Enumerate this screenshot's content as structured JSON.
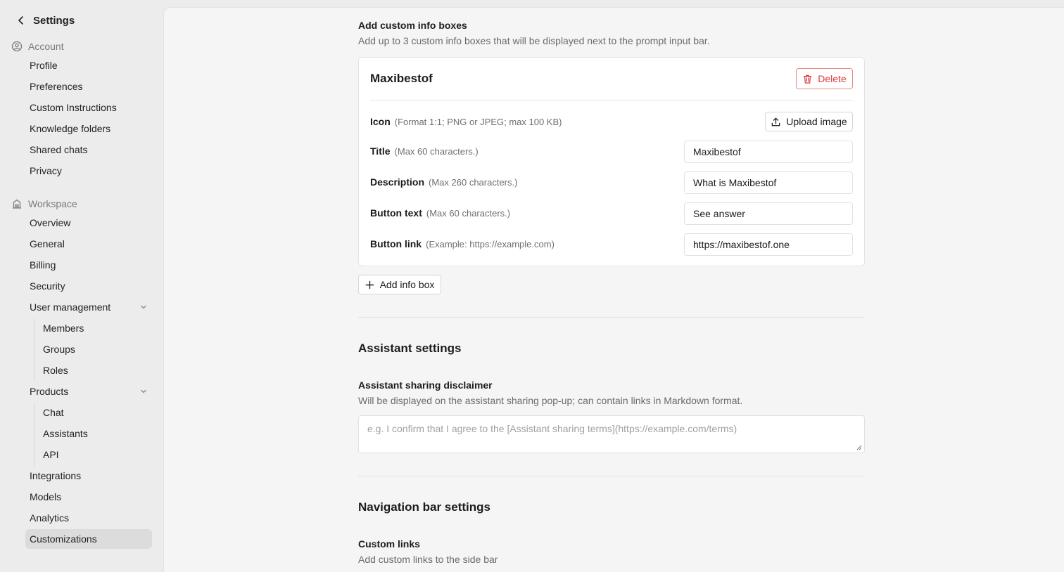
{
  "sidebar": {
    "back_label": "Settings",
    "account_section": "Account",
    "account_items": [
      "Profile",
      "Preferences",
      "Custom Instructions",
      "Knowledge folders",
      "Shared chats",
      "Privacy"
    ],
    "workspace_section": "Workspace",
    "workspace_items": {
      "overview": "Overview",
      "general": "General",
      "billing": "Billing",
      "security": "Security",
      "user_management": "User management",
      "members": "Members",
      "groups": "Groups",
      "roles": "Roles",
      "products": "Products",
      "chat": "Chat",
      "assistants": "Assistants",
      "api": "API",
      "integrations": "Integrations",
      "models": "Models",
      "analytics": "Analytics",
      "customizations": "Customizations"
    }
  },
  "info_boxes": {
    "heading": "Add custom info boxes",
    "description": "Add up to 3 custom info boxes that will be displayed next to the prompt input bar.",
    "card": {
      "title": "Maxibestof",
      "delete_label": "Delete",
      "icon_label": "Icon",
      "icon_hint": "(Format 1:1; PNG or JPEG; max 100 KB)",
      "upload_label": "Upload image",
      "title_label": "Title",
      "title_hint": "(Max 60 characters.)",
      "title_value": "Maxibestof",
      "description_label": "Description",
      "description_hint": "(Max 260 characters.)",
      "description_value": "What is Maxibestof",
      "button_text_label": "Button text",
      "button_text_hint": "(Max 60 characters.)",
      "button_text_value": "See answer",
      "button_link_label": "Button link",
      "button_link_hint": "(Example: https://example.com)",
      "button_link_value": "https://maxibestof.one"
    },
    "add_label": "Add info box"
  },
  "assistant_settings": {
    "heading": "Assistant settings",
    "disclaimer_label": "Assistant sharing disclaimer",
    "disclaimer_desc": "Will be displayed on the assistant sharing pop-up; can contain links in Markdown format.",
    "disclaimer_placeholder": "e.g. I confirm that I agree to the [Assistant sharing terms](https://example.com/terms)"
  },
  "nav_settings": {
    "heading": "Navigation bar settings",
    "custom_links_label": "Custom links",
    "custom_links_desc": "Add custom links to the side bar"
  },
  "colors": {
    "accent_danger": "#dc3b3b",
    "sidebar_bg": "#ececec",
    "main_bg": "#f5f5f5",
    "active_bg": "#dcdcdc"
  }
}
